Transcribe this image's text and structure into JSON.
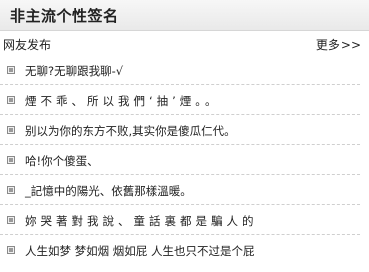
{
  "header": {
    "title": "非主流个性签名"
  },
  "subbar": {
    "tab": "网友发布",
    "more_label": "更多",
    "more_arrow": ">>"
  },
  "list": {
    "items": [
      {
        "text": "无聊?无聊跟我聊-√"
      },
      {
        "text": "煙不乖、所以我們‘抽’煙。。"
      },
      {
        "text": "别以为你的东方不败,其实你是傻瓜仁代。"
      },
      {
        "text": "哈!你个傻蛋、"
      },
      {
        "text": "_記憶中的陽光、依舊那樣溫暖。"
      },
      {
        "text": "妳哭著對我說、童話裏都是騙人的"
      },
      {
        "text": "人生如梦 梦如烟 烟如屁 人生也只不过是个屁"
      }
    ]
  }
}
